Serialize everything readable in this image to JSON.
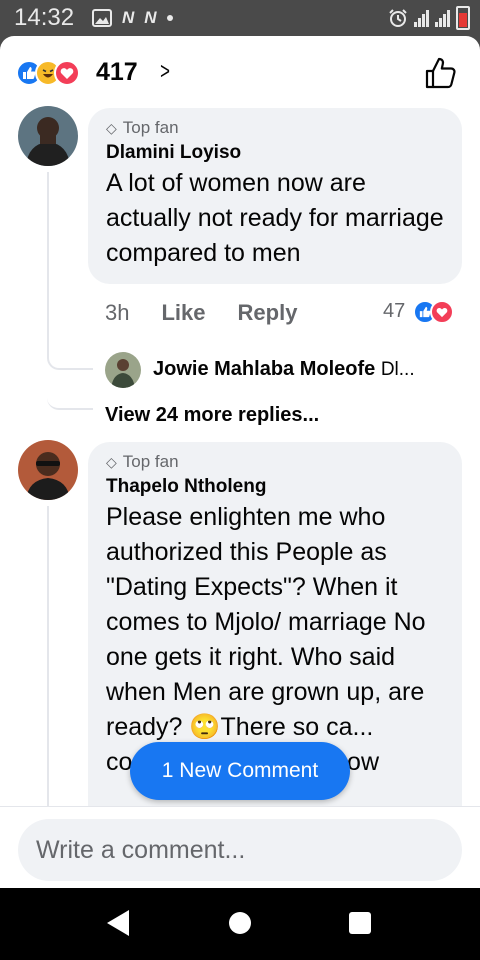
{
  "status_bar": {
    "time": "14:32",
    "icons": [
      "image-icon",
      "app-notification-icon",
      "app-notification-icon",
      "dot-icon",
      "alarm-icon",
      "hd-signal-icon",
      "signal-icon",
      "battery-low-icon"
    ],
    "notif_letter": "N",
    "battery_color": "#e53935"
  },
  "reactions": {
    "icons": [
      "like-icon",
      "haha-icon",
      "love-icon"
    ],
    "count": "417",
    "chevron": ">"
  },
  "comments": [
    {
      "badge": "Top fan",
      "name": "Dlamini Loyiso",
      "text": "A lot of women now are actually not ready for marriage compared to men",
      "time": "3h",
      "like_label": "Like",
      "reply_label": "Reply",
      "reaction_count": "47",
      "reply_preview": {
        "name": "Jowie Mahlaba Moleofe",
        "snippet": "Dl..."
      },
      "more_replies": "View 24 more replies..."
    },
    {
      "badge": "Top fan",
      "name": "Thapelo Ntholeng",
      "text": "Please enlighten me who authorized this People as \"Dating Expects\"?  When it comes to Mjolo/ marriage No one gets it right. Who said when Men are grown up, are ready? 🙄There so ca... coaches don't they know"
    }
  ],
  "new_comment_button": "1 New Comment",
  "composer": {
    "placeholder": "Write a comment..."
  },
  "colors": {
    "accent": "#1877f2",
    "like": "#1877f2",
    "love": "#f33e58",
    "haha": "#f7b928",
    "bubble": "#f0f2f5"
  }
}
